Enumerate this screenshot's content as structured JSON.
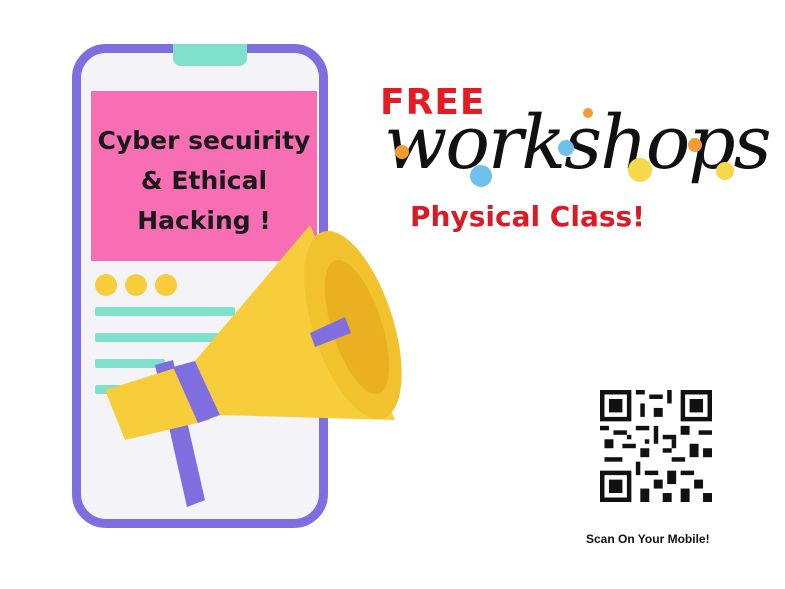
{
  "phone_card": {
    "title": "Cyber secuirity\n& Ethical\nHacking !"
  },
  "headline": {
    "free": "FREE",
    "workshops": "workshops",
    "subtitle": "Physical Class!"
  },
  "qr": {
    "caption": "Scan On Your Mobile!"
  },
  "icons": {
    "megaphone": "megaphone-icon",
    "qr_code": "qr-code-icon",
    "phone": "phone-icon"
  },
  "colors": {
    "purple": "#7e6ee0",
    "pink": "#f76eb4",
    "mint": "#7fe0cc",
    "yellow": "#f7cd3c",
    "red": "#e51b23"
  }
}
